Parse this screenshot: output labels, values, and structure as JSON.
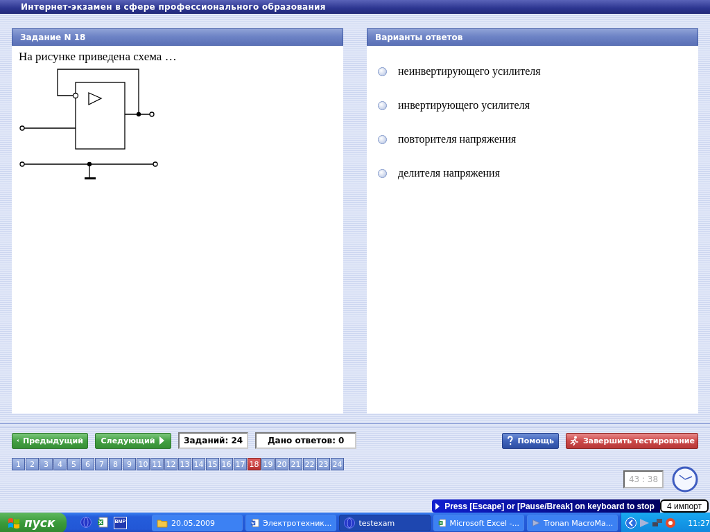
{
  "window": {
    "title": "Интернет-экзамен в сфере профессионального образования"
  },
  "task_panel": {
    "title": "Задание N 18",
    "question": "На рисунке приведена схема …"
  },
  "answers_panel": {
    "title": "Варианты ответов",
    "options": [
      {
        "label": "неинвертирующего усилителя",
        "selected": false
      },
      {
        "label": "инвертирующего усилителя",
        "selected": false
      },
      {
        "label": "повторителя напряжения",
        "selected": false
      },
      {
        "label": "делителя напряжения",
        "selected": false
      }
    ]
  },
  "navigation": {
    "buttons": [
      {
        "kind": "prev",
        "label": "Предыдущий"
      },
      {
        "kind": "next",
        "label": "Следующий"
      }
    ],
    "counters": [
      "Заданий: 24",
      "Дано ответов: 0"
    ],
    "help_button": "Помощь",
    "finish_button": "Завершить тестирование"
  },
  "task_numbers": [
    {
      "label": "1",
      "selected": false
    },
    {
      "label": "2",
      "selected": false
    },
    {
      "label": "3",
      "selected": false
    },
    {
      "label": "4",
      "selected": false
    },
    {
      "label": "5",
      "selected": false
    },
    {
      "label": "6",
      "selected": false
    },
    {
      "label": "7",
      "selected": false
    },
    {
      "label": "8",
      "selected": false
    },
    {
      "label": "9",
      "selected": false
    },
    {
      "label": "10",
      "selected": false
    },
    {
      "label": "11",
      "selected": false
    },
    {
      "label": "12",
      "selected": false
    },
    {
      "label": "13",
      "selected": false
    },
    {
      "label": "14",
      "selected": false
    },
    {
      "label": "15",
      "selected": false
    },
    {
      "label": "16",
      "selected": false
    },
    {
      "label": "17",
      "selected": false
    },
    {
      "label": "18",
      "selected": true
    },
    {
      "label": "19",
      "selected": false
    },
    {
      "label": "20",
      "selected": false
    },
    {
      "label": "21",
      "selected": false
    },
    {
      "label": "22",
      "selected": false
    },
    {
      "label": "23",
      "selected": false
    },
    {
      "label": "24",
      "selected": false
    }
  ],
  "timer": "43 : 38",
  "macro_banner": {
    "message": "Press [Escape] or [Pause/Break] on keyboard to stop",
    "status": "4 импорт"
  },
  "taskbar": {
    "start": "пуск",
    "quick_launch": [
      {
        "kind": "globe"
      },
      {
        "kind": "excel"
      },
      {
        "kind": "bmp",
        "label": "BMP"
      }
    ],
    "tasks": [
      {
        "kind": "folder",
        "label": "20.05.2009",
        "selected": false
      },
      {
        "kind": "word",
        "label": "Электротехник...",
        "selected": false
      },
      {
        "kind": "globe",
        "label": "testexam",
        "selected": true
      },
      {
        "kind": "excel",
        "label": "Microsoft Excel -...",
        "selected": false
      },
      {
        "kind": "play",
        "label": "Tronan MacroMa...",
        "selected": false
      }
    ],
    "clock": "11:27"
  }
}
